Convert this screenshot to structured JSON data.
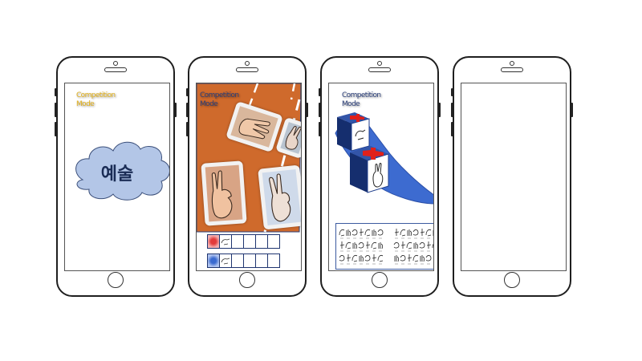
{
  "colors": {
    "phone_outline": "#1f1f1f",
    "cloud_fill": "#b3c6e7",
    "cloud_stroke": "#3b4f7a",
    "board_orange": "#cf6a2c",
    "cube_blue": "#1f3e8c",
    "mat_blue": "#3d6bd0",
    "cube_cross": "#e0201a",
    "label_gold": "#e3b11a",
    "label_navy": "#2b3f7a"
  },
  "phones": [
    {
      "mode_label": "Competition Mode",
      "cloud_word": "예술"
    },
    {
      "mode_label": "Competition Mode"
    },
    {
      "mode_label": "Competition Mode"
    },
    {}
  ]
}
